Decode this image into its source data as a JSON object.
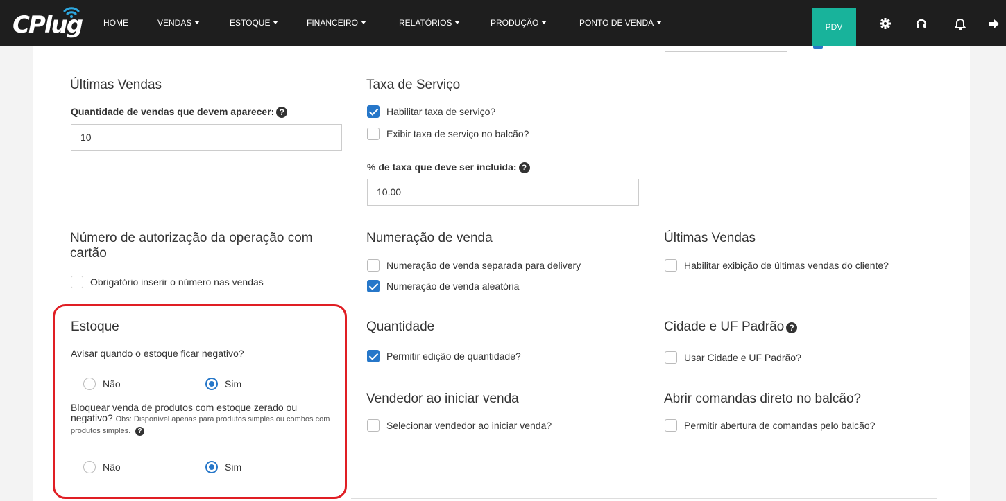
{
  "nav": {
    "logo": "CPlug",
    "items": [
      {
        "label": "HOME",
        "dropdown": false
      },
      {
        "label": "VENDAS",
        "dropdown": true
      },
      {
        "label": "ESTOQUE",
        "dropdown": true
      },
      {
        "label": "FINANCEIRO",
        "dropdown": true
      },
      {
        "label": "RELATÓRIOS",
        "dropdown": true
      },
      {
        "label": "PRODUÇÃO",
        "dropdown": true
      },
      {
        "label": "PONTO DE VENDA",
        "dropdown": true
      }
    ],
    "pdv_label": "PDV",
    "pdv_color": "#18b39b",
    "icons": [
      "gear-icon",
      "headset-icon",
      "bell-icon",
      "logout-icon"
    ]
  },
  "ultimas_vendas_1": {
    "title": "Últimas Vendas",
    "field_label": "Quantidade de vendas que devem aparecer:",
    "value": "10"
  },
  "taxa_servico": {
    "title": "Taxa de Serviço",
    "habilitar": {
      "label": "Habilitar taxa de serviço?",
      "checked": true
    },
    "exibir": {
      "label": "Exibir taxa de serviço no balcão?",
      "checked": false
    },
    "percent_label": "% de taxa que deve ser incluída:",
    "percent_value": "10.00"
  },
  "autorizacao": {
    "title": "Número de autorização da operação com cartão",
    "obrigatorio": {
      "label": "Obrigatório inserir o número nas vendas",
      "checked": false
    }
  },
  "numeracao": {
    "title": "Numeração de venda",
    "separada": {
      "label": "Numeração de venda separada para delivery",
      "checked": false
    },
    "aleatoria": {
      "label": "Numeração de venda aleatória",
      "checked": true
    }
  },
  "ultimas_vendas_2": {
    "title": "Últimas Vendas",
    "habilitar": {
      "label": "Habilitar exibição de últimas vendas do cliente?",
      "checked": false
    }
  },
  "estoque": {
    "title": "Estoque",
    "avisar_label": "Avisar quando o estoque ficar negativo?",
    "avisar_options": [
      "Não",
      "Sim"
    ],
    "avisar_selected": "Sim",
    "bloquear_label": "Bloquear venda de produtos com estoque zerado ou negativo?",
    "bloquear_obs": "Obs: Disponível apenas para produtos simples ou combos com produtos simples.",
    "bloquear_options": [
      "Não",
      "Sim"
    ],
    "bloquear_selected": "Sim"
  },
  "quantidade": {
    "title": "Quantidade",
    "permitir": {
      "label": "Permitir edição de quantidade?",
      "checked": true
    }
  },
  "cidade_uf": {
    "title": "Cidade e UF Padrão",
    "usar": {
      "label": "Usar Cidade e UF Padrão?",
      "checked": false
    }
  },
  "vendedor": {
    "title": "Vendedor ao iniciar venda",
    "selecionar": {
      "label": "Selecionar vendedor ao iniciar venda?",
      "checked": false
    }
  },
  "comandas": {
    "title": "Abrir comandas direto no balcão?",
    "permitir": {
      "label": "Permitir abertura de comandas pelo balcão?",
      "checked": false
    }
  },
  "colors": {
    "accent": "#2677c9",
    "highlight": "#e01e24",
    "navbar": "#1e1e1e"
  }
}
